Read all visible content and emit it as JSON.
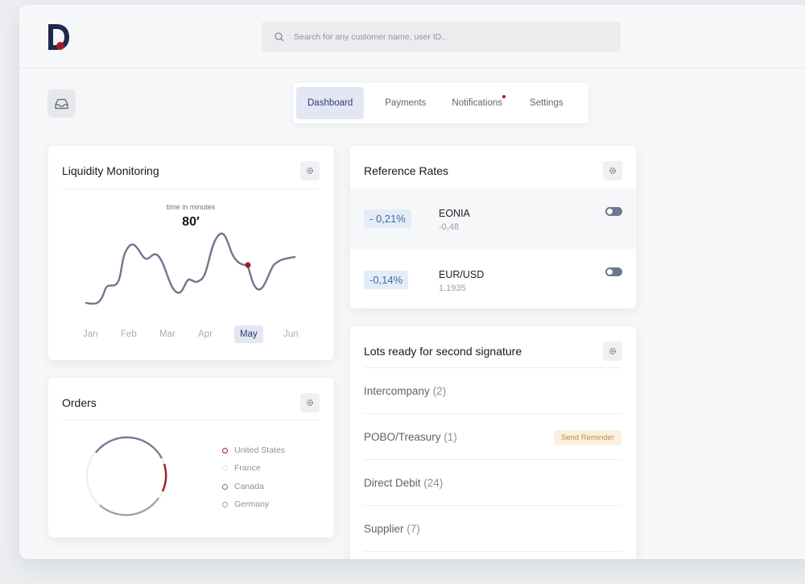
{
  "search": {
    "placeholder": "Search for any customer name, user ID.."
  },
  "tabs": [
    {
      "label": "Dashboard",
      "active": true
    },
    {
      "label": "Payments",
      "active": false
    },
    {
      "label": "Notifications",
      "active": false,
      "has_dot": true
    },
    {
      "label": "Settings",
      "active": false
    }
  ],
  "liquidity": {
    "title": "Liquidity Monitoring",
    "caption": "time in minutes",
    "value": "80′",
    "months": [
      "Jan",
      "Feb",
      "Mar",
      "Apr",
      "May",
      "Jun"
    ],
    "active_month": "May"
  },
  "orders": {
    "title": "Orders",
    "legend": [
      "United States",
      "France",
      "Canada",
      "Germany"
    ]
  },
  "rates": {
    "title": "Reference Rates",
    "rows": [
      {
        "change": "- 0,21%",
        "name": "EONIA",
        "value": "-0,48"
      },
      {
        "change": "-0,14%",
        "name": "EUR/USD",
        "value": "1.1935"
      }
    ]
  },
  "lots": {
    "title": "Lots ready for second signature",
    "rows": [
      {
        "label": "Intercompany",
        "count": "(2)"
      },
      {
        "label": "POBO/Treasury",
        "count": "(1)",
        "action": "Send Reminder"
      },
      {
        "label": "Direct Debit",
        "count": "(24)"
      },
      {
        "label": "Supplier",
        "count": "(7)"
      }
    ]
  },
  "colors": {
    "accent": "#a11c22",
    "line": "#6c7791",
    "active_tab_bg": "#e3e6f3"
  }
}
